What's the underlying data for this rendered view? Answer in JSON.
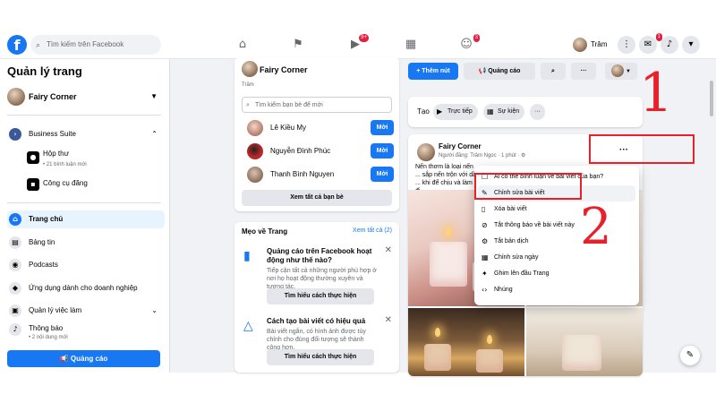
{
  "topbar": {
    "logo": "f",
    "search_placeholder": "Tìm kiếm trên Facebook",
    "nav_badges": {
      "watch": "9+",
      "groups": "3"
    },
    "profile_name": "Trâm",
    "messenger_badge": "1"
  },
  "sidebar": {
    "title": "Quản lý trang",
    "page_name": "Fairy Corner",
    "items": [
      {
        "label": "Business Suite",
        "icon": "business-suite-icon",
        "glyph": "›"
      },
      {
        "label": "Hộp thư",
        "sub": "• 21 bình luận mới",
        "icon": "inbox-icon",
        "glyph": "●"
      },
      {
        "label": "Công cụ đăng",
        "icon": "publishing-tools-icon",
        "glyph": "▪"
      },
      {
        "label": "Trang chủ",
        "icon": "home-icon",
        "glyph": "⌂"
      },
      {
        "label": "Bảng tin",
        "icon": "news-feed-icon",
        "glyph": "▤"
      },
      {
        "label": "Podcasts",
        "icon": "podcast-icon",
        "glyph": "◉"
      },
      {
        "label": "Ứng dụng dành cho doanh nghiệp",
        "icon": "business-apps-icon",
        "glyph": "◆"
      },
      {
        "label": "Quản lý việc làm",
        "icon": "jobs-icon",
        "glyph": "▣"
      },
      {
        "label": "Thông báo",
        "sub": "• 2 nội dung mới",
        "icon": "bell-icon",
        "glyph": "♪"
      }
    ],
    "ads_button": "Quảng cáo"
  },
  "middle": {
    "page_name": "Fairy Corner",
    "partial_text": "Trâm",
    "invite_placeholder": "Tìm kiếm bạn bè để mời",
    "friends": [
      {
        "name": "Lê Kiều My",
        "action": "Mời"
      },
      {
        "name": "Nguyễn Đình Phúc",
        "action": "Mời"
      },
      {
        "name": "Thanh Bình Nguyen",
        "action": "Mời"
      }
    ],
    "see_all_friends": "Xem tất cả bạn bè",
    "tips_title": "Mẹo về Trang",
    "tips_link": "Xem tất cả (2)",
    "tips": [
      {
        "title": "Quảng cáo trên Facebook hoạt động như thế nào?",
        "desc": "Tiếp cận tất cả những người phù hợp ở nơi họ hoạt động thường xuyên và tương tác.",
        "button": "Tìm hiểu cách thực hiện"
      },
      {
        "title": "Cách tạo bài viết có hiệu quả",
        "desc": "Bài viết ngắn, có hình ảnh được tùy chỉnh cho đúng đối tượng sẽ thành công hơn.",
        "button": "Tìm hiểu cách thực hiện"
      }
    ]
  },
  "right": {
    "add_button": "+ Thêm nút",
    "ads_button": "Quảng cáo",
    "create_label": "Tạo",
    "chips": [
      "Trực tiếp",
      "Sự kiện"
    ],
    "post": {
      "page_name": "Fairy Corner",
      "meta": "Người đăng: Trâm Ngọc · 1 phút · ⚙",
      "text": "Nến thơm là loại nến ... sắp nến trộn với dầu ... khi để chịu và làm đi..."
    }
  },
  "menu": {
    "items": [
      {
        "label": "Ai có thể bình luận về bài viết của bạn?",
        "icon": "comment-settings-icon",
        "glyph": "☐"
      },
      {
        "label": "Chỉnh sửa bài viết",
        "icon": "pencil-icon",
        "glyph": "✎"
      },
      {
        "label": "Xóa bài viết",
        "icon": "trash-icon",
        "glyph": "🗑"
      },
      {
        "label": "Tắt thông báo về bài viết này",
        "icon": "bell-off-icon",
        "glyph": "⊘"
      },
      {
        "label": "Tắt bản dịch",
        "icon": "translate-icon",
        "glyph": "⚙"
      },
      {
        "label": "Chỉnh sửa ngày",
        "icon": "calendar-icon",
        "glyph": "▦"
      },
      {
        "label": "Ghim lên đầu Trang",
        "icon": "pin-icon",
        "glyph": "✦"
      },
      {
        "label": "Nhúng",
        "icon": "embed-icon",
        "glyph": "‹›"
      }
    ]
  },
  "annotations": {
    "step1": "1",
    "step2": "2"
  },
  "colors": {
    "brand": "#1877f2",
    "annotation_red": "#e8202a",
    "background": "#f0f2f5"
  }
}
